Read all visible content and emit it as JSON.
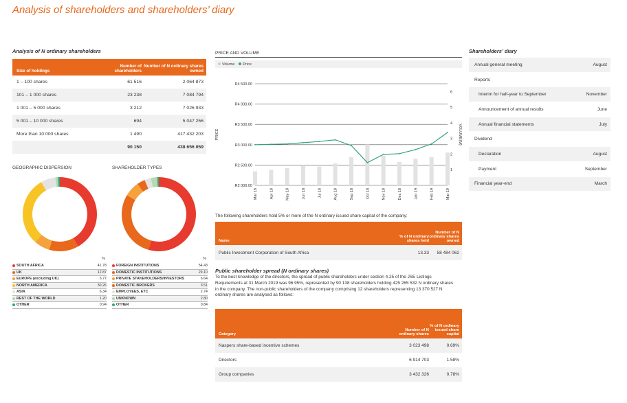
{
  "page_title": "Analysis of shareholders and shareholders’ diary",
  "colors": {
    "accent": "#e8681c",
    "band": "#f1f1f1"
  },
  "holdings": {
    "heading": "Analysis of N ordinary shareholders",
    "columns": [
      "Size of holdings",
      "Number of shareholders",
      "Number of N ordinary shares owned"
    ],
    "rows": [
      [
        "1 – 100 shares",
        "61 516",
        "2 064 873"
      ],
      [
        "101 – 1 000 shares",
        "23 238",
        "7 084 794"
      ],
      [
        "1 001 – 5 000 shares",
        "3 212",
        "7 026 933"
      ],
      [
        "5 001 – 10 000 shares",
        "694",
        "5 047 256"
      ],
      [
        "More than 10 000 shares",
        "1 490",
        "417 432 203"
      ]
    ],
    "total": [
      "",
      "90 150",
      "438 656 059"
    ]
  },
  "geo": {
    "heading": "GEOGRAPHIC DISPERSION",
    "pct_label": "%",
    "items": [
      {
        "name": "SOUTH AFRICA",
        "value": "41.78",
        "color": "#e63b2e"
      },
      {
        "name": "UK",
        "value": "12.87",
        "color": "#e8681c"
      },
      {
        "name": "EUROPE (excluding UK)",
        "value": "6.77",
        "color": "#f5a13c"
      },
      {
        "name": "NORTH AMERICA",
        "value": "30.26",
        "color": "#f8c325"
      },
      {
        "name": "ASIA",
        "value": "6.34",
        "color": "#e3e3e3"
      },
      {
        "name": "REST OF THE WORLD",
        "value": "1.20",
        "color": "#b6d9b0"
      },
      {
        "name": "OTHER",
        "value": "0.94",
        "color": "#34a37a"
      }
    ]
  },
  "types": {
    "heading": "SHAREHOLDER TYPES",
    "pct_label": "%",
    "items": [
      {
        "name": "FOREIGN INSTITUTIONS",
        "value": "54.43",
        "color": "#e63b2e"
      },
      {
        "name": "DOMESTIC INSTITUTIONS",
        "value": "29.10",
        "color": "#e8681c"
      },
      {
        "name": "PRIVATE STAKEHOLDERS/INVESTORS",
        "value": "6.64",
        "color": "#f5a13c"
      },
      {
        "name": "DOMESTIC BROKERS",
        "value": "3.51",
        "color": "#e8681c"
      },
      {
        "name": "EMPLOYEES, ETC",
        "value": "2.74",
        "color": "#e3e3e3"
      },
      {
        "name": "UNKNOWN",
        "value": "2.80",
        "color": "#b6d9b0"
      },
      {
        "name": "OTHER",
        "value": "0.84",
        "color": "#34a37a"
      }
    ]
  },
  "price_volume": {
    "heading": "PRICE AND VOLUME",
    "legend_volume": "Volume",
    "legend_price": "Price",
    "ylabel": "PRICE",
    "y2label": "VOLUME(M)"
  },
  "chart_data": {
    "type": "line",
    "title": "PRICE AND VOLUME",
    "x": [
      "Mar 18",
      "Apr 18",
      "May 18",
      "Jun 18",
      "Jul 18",
      "Aug 18",
      "Sep 18",
      "Oct 18",
      "Nov 18",
      "Dec 18",
      "Jan 19",
      "Feb 19",
      "Mar 19"
    ],
    "y_ticks": [
      "R4 500.00",
      "R4 000.00",
      "R3 500.00",
      "R3 000.00",
      "R2 500.00",
      "R2 000.00"
    ],
    "y2_ticks": [
      "6",
      "5",
      "4",
      "3",
      "2",
      "1"
    ],
    "ylim": [
      2000,
      4500
    ],
    "y2lim": [
      0,
      6.5
    ],
    "series": [
      {
        "name": "Price",
        "values": [
          3000,
          3010,
          3020,
          3050,
          3080,
          3120,
          2980,
          2560,
          2760,
          2780,
          2880,
          3020,
          3300
        ]
      },
      {
        "name": "Volume",
        "values": [
          0.9,
          1.0,
          1.1,
          1.3,
          1.2,
          1.4,
          1.8,
          2.6,
          1.9,
          1.5,
          1.7,
          1.8,
          2.1
        ]
      }
    ]
  },
  "major": {
    "intro": "The following shareholders hold 5% or more of the N ordinary issued share capital of the company:",
    "columns": [
      "Name",
      "% of N ordinary shares held",
      "Number of N ordinary shares owned"
    ],
    "rows": [
      [
        "Public Investment Corporation of South Africa",
        "13.33",
        "58 484 062"
      ]
    ]
  },
  "spread": {
    "heading": "Public shareholder spread (N ordinary shares)",
    "para": "To the best knowledge of the directors, the spread of public shareholders under section 4.25 of the JSE Listings Requirements at 31 March 2019 was 96.95%, represented by 90 138 shareholders holding 425 265 532 N ordinary shares in the company. The non-public shareholders of the company comprising 12 shareholders representing 13 370 527 N ordinary shares are analysed as follows:",
    "columns": [
      "Category",
      "Number of N ordinary shares",
      "% of N ordinary issued share capital"
    ],
    "rows": [
      [
        "Naspers share-based incentive schemes",
        "3 023 498",
        "0.69%"
      ],
      [
        "Directors",
        "6 914 703",
        "1.58%"
      ],
      [
        "Group companies",
        "3 432 326",
        "0.78%"
      ]
    ]
  },
  "diary": {
    "heading": "Shareholders’ diary",
    "rows": [
      {
        "label": "Annual general meeting",
        "value": "August",
        "indent": false
      },
      {
        "label": "Reports",
        "value": "",
        "indent": false
      },
      {
        "label": "Interim for half-year to September",
        "value": "November",
        "indent": true
      },
      {
        "label": "Announcement of annual results",
        "value": "June",
        "indent": true
      },
      {
        "label": "Annual financial statements",
        "value": "July",
        "indent": true
      },
      {
        "label": "Dividend",
        "value": "",
        "indent": false
      },
      {
        "label": "Declaration",
        "value": "August",
        "indent": true
      },
      {
        "label": "Payment",
        "value": "September",
        "indent": true
      },
      {
        "label": "Financial year-end",
        "value": "March",
        "indent": false
      }
    ]
  }
}
